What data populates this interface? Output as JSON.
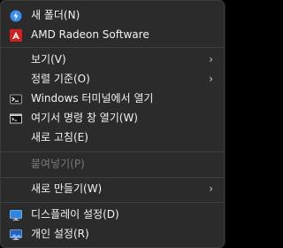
{
  "menu": {
    "items": [
      {
        "label": "새 폴더(N)",
        "icon": "new-folder-icon"
      },
      {
        "label": "AMD Radeon Software",
        "icon": "amd-radeon-icon"
      },
      {
        "label": "보기(V)",
        "submenu": true
      },
      {
        "label": "정렬 기준(O)",
        "submenu": true
      },
      {
        "label": "Windows 터미널에서 열기",
        "icon": "terminal-icon"
      },
      {
        "label": "여기서 명령 창 열기(W)",
        "icon": "command-prompt-icon"
      },
      {
        "label": "새로 고침(E)"
      },
      {
        "label": "붙여넣기(P)",
        "disabled": true
      },
      {
        "label": "새로 만들기(W)",
        "submenu": true
      },
      {
        "label": "디스플레이 설정(D)",
        "icon": "display-settings-icon"
      },
      {
        "label": "개인 설정(R)",
        "icon": "personalize-icon"
      }
    ],
    "submenu_arrow": "›"
  },
  "colors": {
    "background": "#2b2b2b",
    "text": "#f2f2f2",
    "disabled_text": "#787878",
    "separator": "#3f3f3f",
    "accent_blue": "#3b8eea",
    "amd_red": "#d21f1f"
  }
}
